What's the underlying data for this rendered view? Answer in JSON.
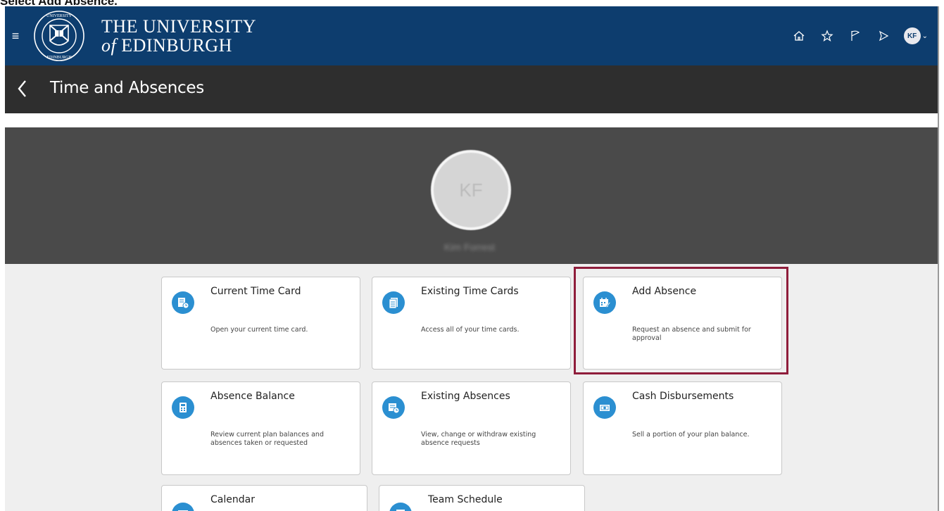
{
  "caption": "Select Add Absence.",
  "header": {
    "menu_icon": "hamburger-icon",
    "logo": "university-crest",
    "brand_line1": "THE UNIVERSITY",
    "brand_line2_of": "of",
    "brand_line2": "EDINBURGH",
    "icons": [
      "home-icon",
      "star-icon",
      "flag-icon",
      "play-icon"
    ],
    "user_initials": "KF"
  },
  "subheader": {
    "back_icon": "chevron-left-icon",
    "title": "Time and Absences"
  },
  "profile": {
    "initials": "KF",
    "name": "Kim Forrest"
  },
  "cards": [
    {
      "title": "Current Time Card",
      "description": "Open your current time card.",
      "icon": "time-card-icon"
    },
    {
      "title": "Existing Time Cards",
      "description": "Access all of your time cards.",
      "icon": "documents-icon"
    },
    {
      "title": "Add Absence",
      "description": "Request an absence and submit for approval",
      "icon": "calendar-edit-icon"
    },
    {
      "title": "Absence Balance",
      "description": "Review current plan balances and absences taken or requested",
      "icon": "calculator-icon"
    },
    {
      "title": "Existing Absences",
      "description": "View, change or withdraw existing absence requests",
      "icon": "absence-list-icon"
    },
    {
      "title": "Cash Disbursements",
      "description": "Sell a portion of your plan balance.",
      "icon": "cash-icon"
    },
    {
      "title": "Calendar",
      "description": "",
      "icon": "calendar-icon"
    },
    {
      "title": "Team Schedule",
      "description": "",
      "icon": "schedule-icon"
    }
  ],
  "colors": {
    "header_bg": "#0d3d6e",
    "subheader_bg": "#2e2e2e",
    "hero_bg": "#4a4a4a",
    "icon_blue": "#2b8fd1",
    "highlight": "#8f1d3b"
  }
}
